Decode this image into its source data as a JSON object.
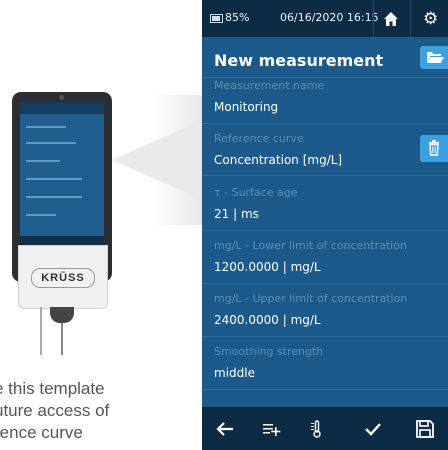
{
  "caption": [
    "e this template",
    "uture access of",
    "rence curve"
  ],
  "device": {
    "logo_text": "KRŪSS"
  },
  "status_bar": {
    "battery": "85%",
    "datetime": "06/16/2020  16:15"
  },
  "screen": {
    "title": "New measurement",
    "fields": [
      {
        "label": "Measurement name",
        "value": "Monitoring"
      },
      {
        "label": "Reference curve",
        "value": "Concentration [mg/L]"
      },
      {
        "label": "τ -  Surface age",
        "value": "21 | ms"
      },
      {
        "label": "mg/L - Lower limit of concentration",
        "value": "1200.0000 | mg/L"
      },
      {
        "label": "mg/L - Upper limit of concentration",
        "value": "2400.0000 | mg/L"
      },
      {
        "label": "Smoothing strength",
        "value": "middle"
      }
    ]
  },
  "colors": {
    "status_bar": "#0e2b44",
    "panel": "#1b5a8a",
    "accent_button": "#3da0e3",
    "label": "#5d8eb6"
  },
  "icons": [
    "home-icon",
    "gear-icon",
    "folder-icon",
    "trash-icon",
    "back-arrow-icon",
    "add-list-icon",
    "thermometer-icon",
    "check-icon",
    "save-icon"
  ]
}
